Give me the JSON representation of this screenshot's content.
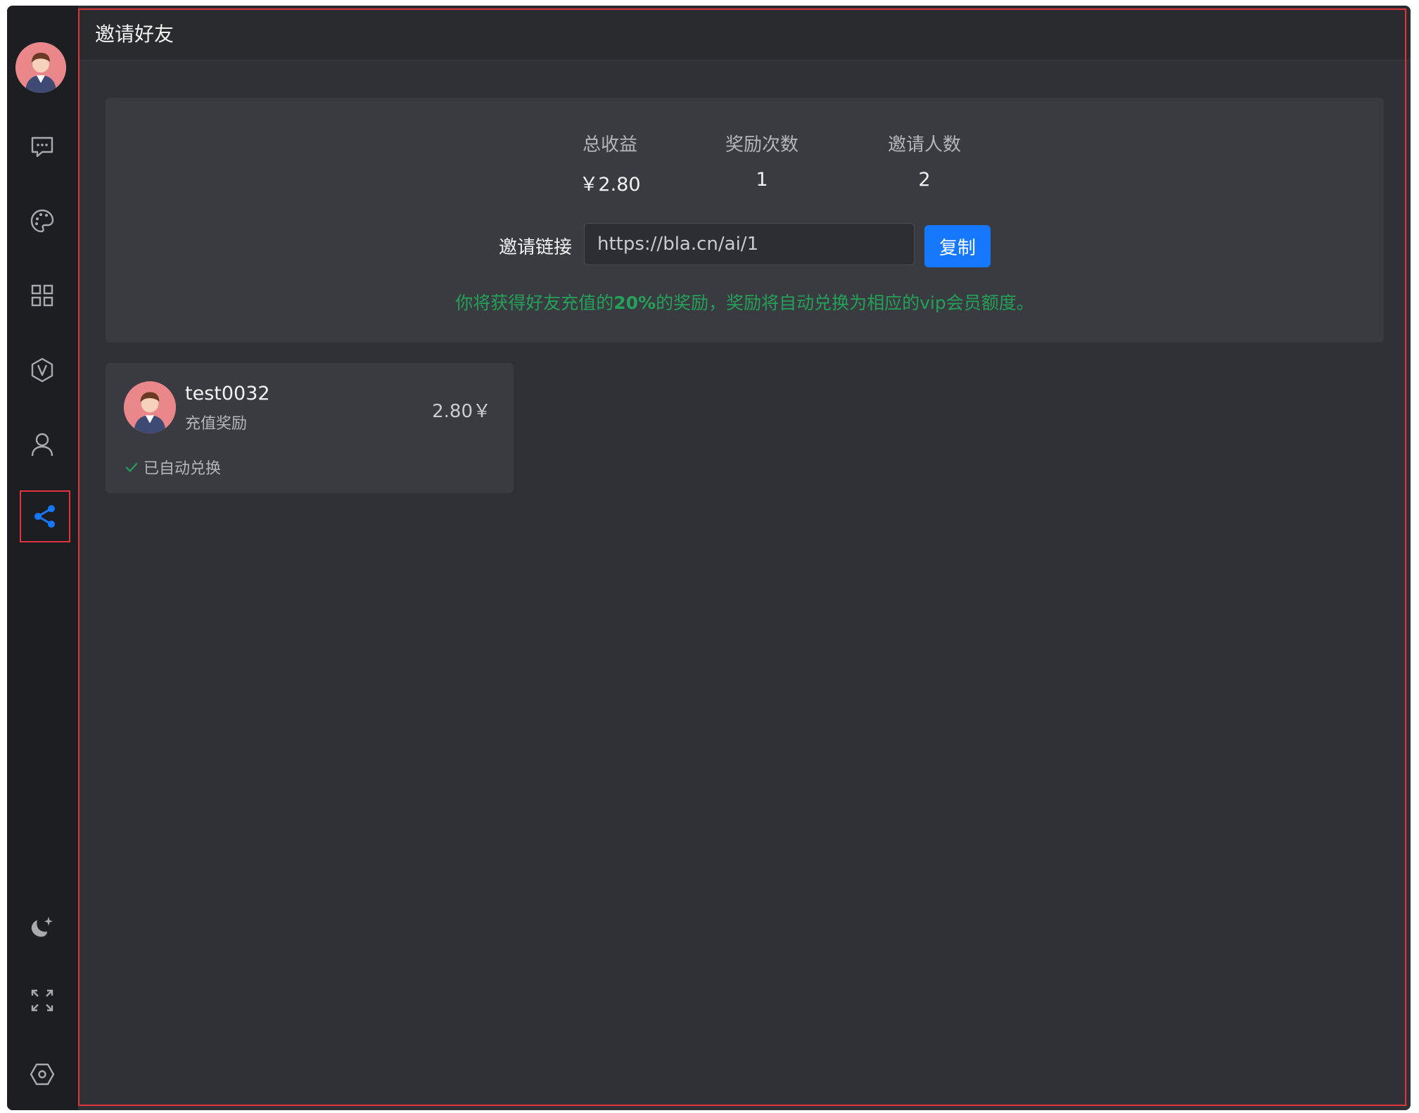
{
  "page": {
    "title": "邀请好友"
  },
  "sidebar": {
    "items": [
      {
        "icon": "chat-icon"
      },
      {
        "icon": "palette-icon"
      },
      {
        "icon": "grid-icon"
      },
      {
        "icon": "vip-icon"
      },
      {
        "icon": "user-icon"
      },
      {
        "icon": "share-icon",
        "active": true
      }
    ],
    "bottom": [
      {
        "icon": "moon-icon"
      },
      {
        "icon": "fullscreen-icon"
      },
      {
        "icon": "settings-icon"
      }
    ]
  },
  "stats": {
    "total_income_label": "总收益",
    "total_income_value": "￥2.80",
    "reward_count_label": "奖励次数",
    "reward_count_value": "1",
    "invite_count_label": "邀请人数",
    "invite_count_value": "2"
  },
  "invite": {
    "label": "邀请链接",
    "link": "https://bla.cn/ai/1",
    "copy_label": "复制",
    "note_prefix": "你将获得好友充值的",
    "note_percent": "20%",
    "note_suffix": "的奖励，奖励将自动兑换为相应的vip会员额度。"
  },
  "rewards": [
    {
      "user": "test0032",
      "type": "充值奖励",
      "amount": "2.80￥",
      "status": "已自动兑换"
    }
  ],
  "colors": {
    "accent": "#1677ff",
    "success": "#24a058",
    "highlight": "#e0353c"
  }
}
